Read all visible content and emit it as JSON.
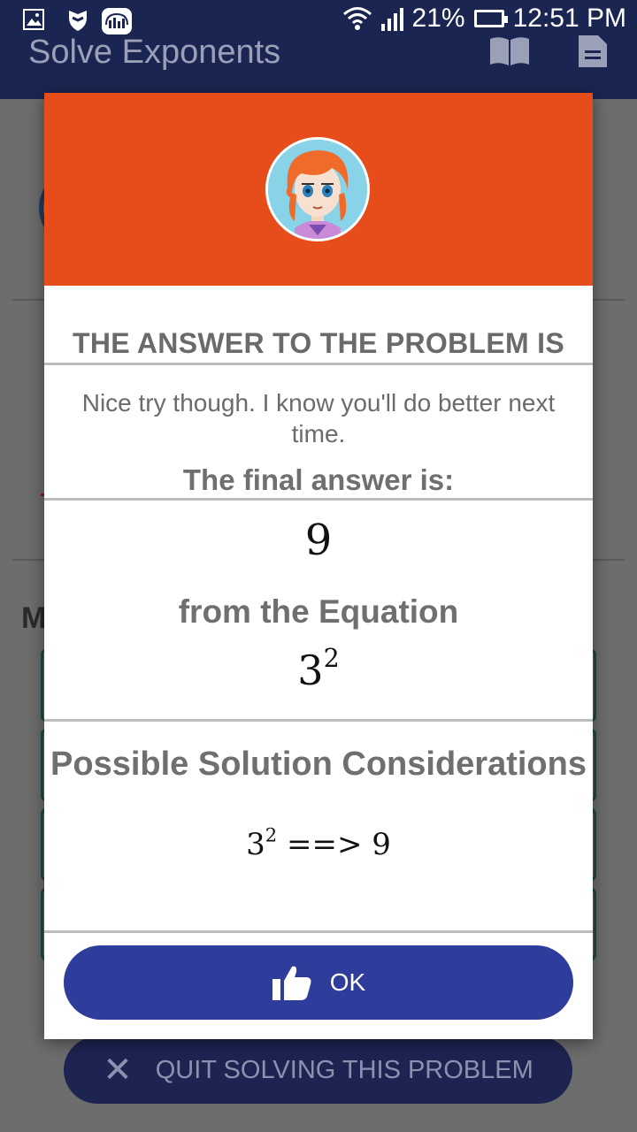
{
  "status_bar": {
    "battery": "21%",
    "time": "12:51 PM",
    "icons": [
      "image-icon",
      "shield-icon",
      "audio-icon",
      "wifi-icon",
      "signal-icon",
      "battery-icon"
    ]
  },
  "app_bar": {
    "title": "Solve Exponents",
    "icons": [
      "book-icon",
      "document-icon"
    ]
  },
  "background": {
    "partial_label": "M"
  },
  "dialog": {
    "heading": "THE ANSWER TO THE PROBLEM IS",
    "message": "Nice try though. I know you'll do better next time.",
    "final_label": "The final answer is:",
    "answer": "9",
    "from_label": "from the Equation",
    "equation": {
      "base": "3",
      "exponent": "2"
    },
    "considerations_title": "Possible Solution Considerations",
    "consideration": {
      "base": "3",
      "exponent": "2",
      "arrow": "==>",
      "result": "9"
    },
    "ok_label": "OK"
  },
  "quit_button": {
    "label": "QUIT SOLVING THIS PROBLEM"
  },
  "colors": {
    "header_orange": "#e64d1a",
    "primary_blue": "#2e3d9c",
    "app_bar_navy": "#1b2551",
    "heading_gray": "#6a6a6a"
  }
}
